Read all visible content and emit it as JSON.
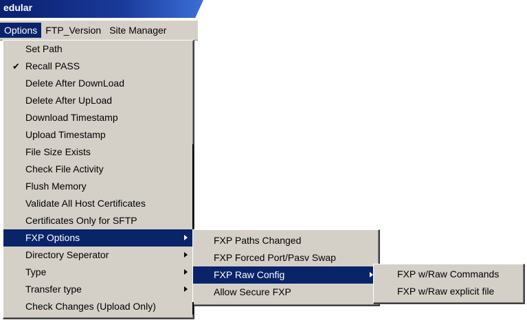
{
  "window": {
    "title": "edular"
  },
  "menubar": {
    "items": [
      "Options",
      "FTP_Version",
      "Site Manager"
    ]
  },
  "options_menu": {
    "items": [
      {
        "label": "Set Path"
      },
      {
        "label": "Recall PASS",
        "checked": true
      },
      {
        "label": "Delete After DownLoad"
      },
      {
        "label": "Delete After UpLoad"
      },
      {
        "label": "Download Timestamp"
      },
      {
        "label": "Upload Timestamp"
      },
      {
        "label": "File Size Exists"
      },
      {
        "label": "Check File Activity"
      },
      {
        "label": "Flush Memory"
      },
      {
        "label": "Validate All Host Certificates"
      },
      {
        "label": "Certificates Only for SFTP"
      },
      {
        "label": "FXP Options",
        "submenu": true,
        "highlighted": true
      },
      {
        "label": "Directory Seperator",
        "submenu": true
      },
      {
        "label": "Type",
        "submenu": true
      },
      {
        "label": "Transfer type",
        "submenu": true
      },
      {
        "label": "Check Changes (Upload Only)"
      }
    ],
    "check_glyph": "✔"
  },
  "fxp_menu": {
    "items": [
      {
        "label": "FXP Paths Changed"
      },
      {
        "label": "FXP Forced Port/Pasv Swap"
      },
      {
        "label": "FXP Raw Config",
        "submenu": true,
        "highlighted": true
      },
      {
        "label": "Allow Secure FXP"
      }
    ]
  },
  "raw_menu": {
    "items": [
      {
        "label": "FXP w/Raw Commands"
      },
      {
        "label": "FXP w/Raw explicit file"
      }
    ]
  }
}
